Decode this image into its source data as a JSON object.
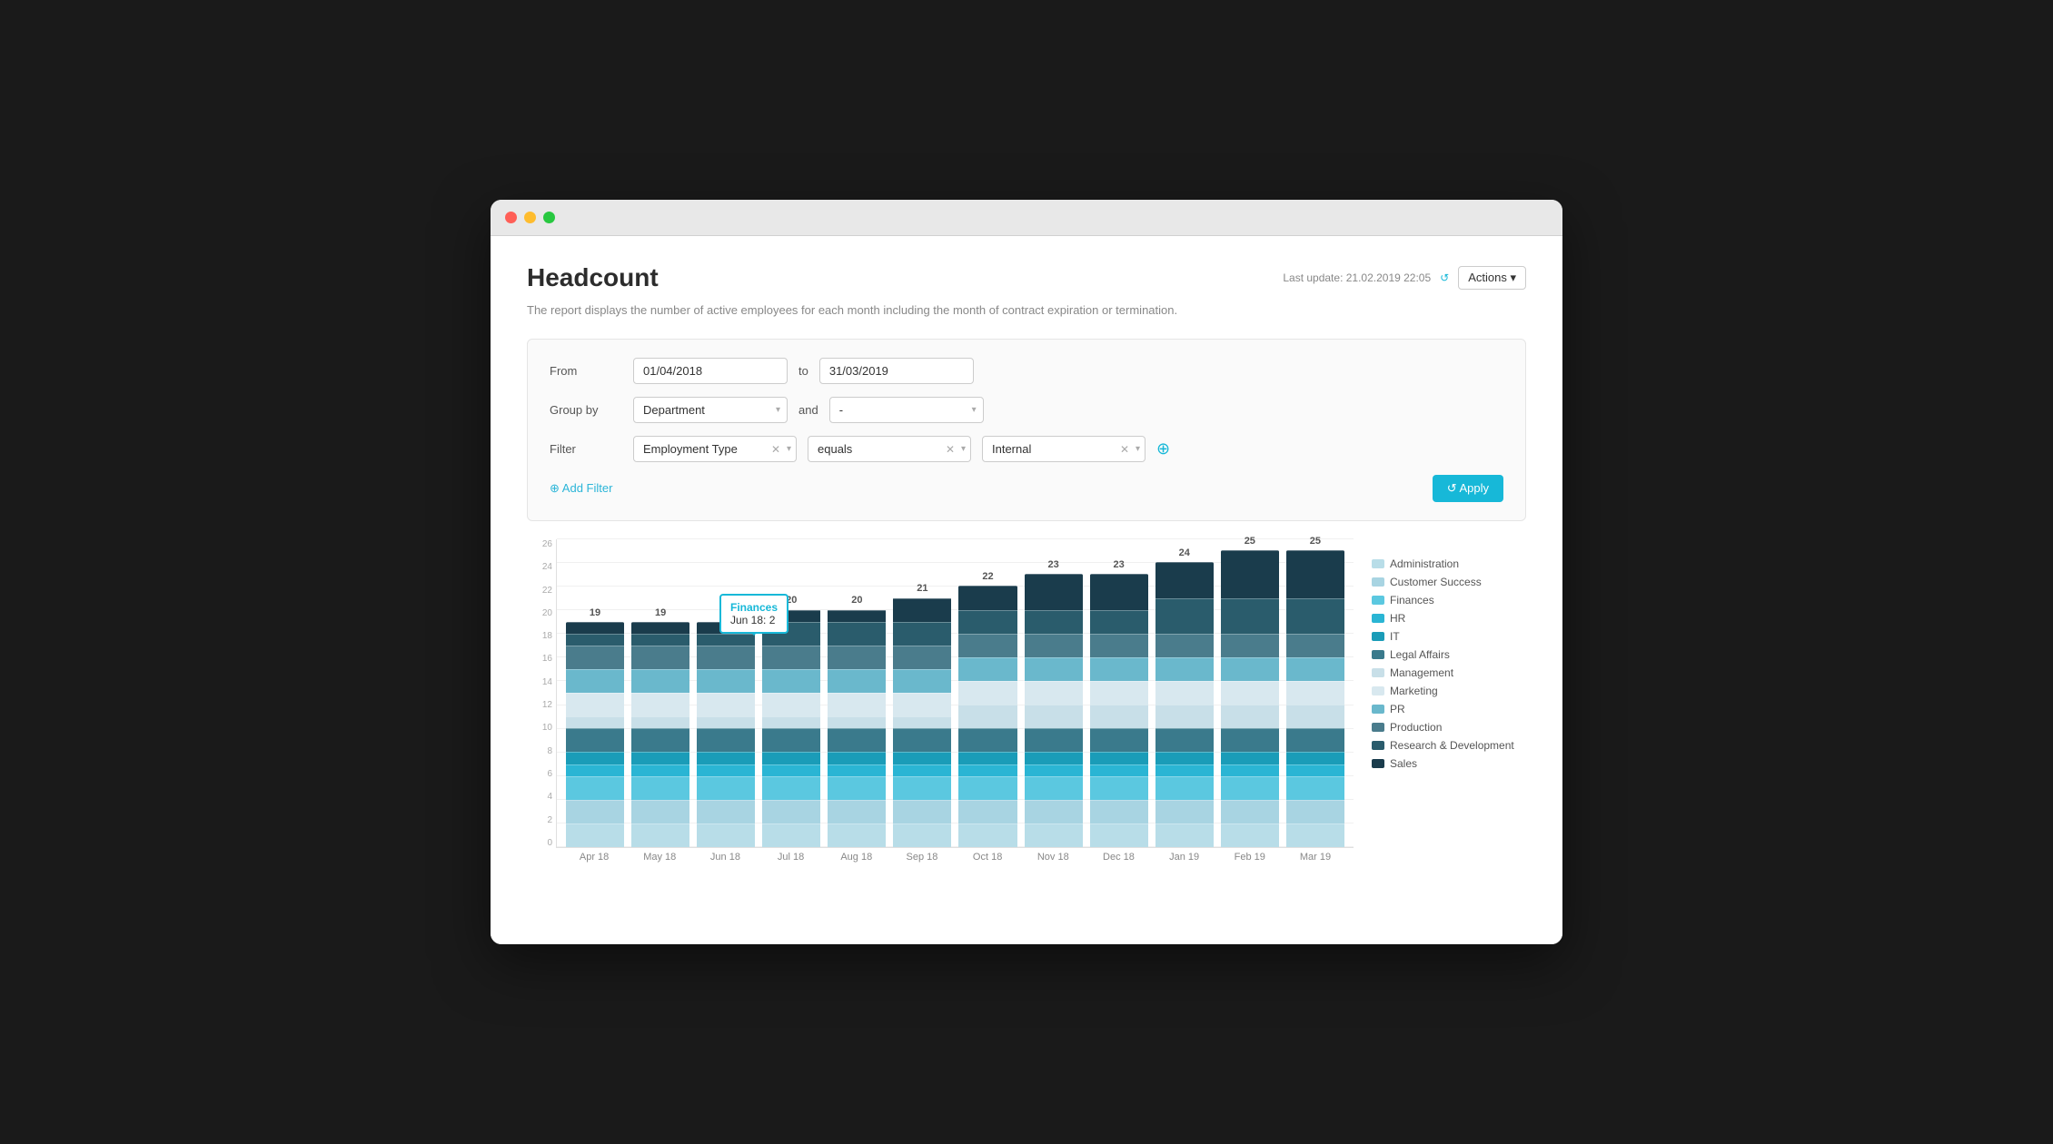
{
  "window": {
    "title": "Headcount"
  },
  "header": {
    "title": "Headcount",
    "last_update": "Last update: 21.02.2019 22:05",
    "actions_label": "Actions ▾",
    "description": "The report displays the number of active employees for each month including the month of contract expiration or termination."
  },
  "form": {
    "from_label": "From",
    "from_value": "01/04/2018",
    "to_label": "to",
    "to_value": "31/03/2019",
    "group_by_label": "Group by",
    "group_by_value": "Department",
    "and_label": "and",
    "and_value": "-",
    "filter_label": "Filter",
    "filter_field": "Employment Type",
    "filter_op": "equals",
    "filter_value": "Internal",
    "add_filter_label": "⊕ Add Filter",
    "apply_label": "↺ Apply"
  },
  "chart": {
    "bars": [
      {
        "month": "Apr 18",
        "total": 19,
        "segments": [
          2,
          2,
          2,
          1,
          1,
          2,
          1,
          2,
          2,
          2,
          1,
          1
        ]
      },
      {
        "month": "May 18",
        "total": 19,
        "segments": [
          2,
          2,
          2,
          1,
          1,
          2,
          1,
          2,
          2,
          2,
          1,
          1
        ]
      },
      {
        "month": "Jun 18",
        "total": 19,
        "segments": [
          2,
          2,
          2,
          1,
          1,
          2,
          1,
          2,
          2,
          2,
          1,
          1
        ]
      },
      {
        "month": "Jul 18",
        "total": 20,
        "segments": [
          2,
          2,
          2,
          1,
          1,
          2,
          1,
          2,
          2,
          2,
          2,
          1
        ]
      },
      {
        "month": "Aug 18",
        "total": 20,
        "segments": [
          2,
          2,
          2,
          1,
          1,
          2,
          1,
          2,
          2,
          2,
          2,
          1
        ]
      },
      {
        "month": "Sep 18",
        "total": 21,
        "segments": [
          2,
          2,
          2,
          1,
          1,
          2,
          1,
          2,
          2,
          2,
          2,
          2
        ]
      },
      {
        "month": "Oct 18",
        "total": 22,
        "segments": [
          2,
          2,
          2,
          1,
          1,
          2,
          2,
          2,
          2,
          2,
          2,
          2
        ]
      },
      {
        "month": "Nov 18",
        "total": 23,
        "segments": [
          2,
          2,
          2,
          1,
          1,
          2,
          2,
          2,
          2,
          2,
          2,
          3
        ]
      },
      {
        "month": "Dec 18",
        "total": 23,
        "segments": [
          2,
          2,
          2,
          1,
          1,
          2,
          2,
          2,
          2,
          2,
          2,
          3
        ]
      },
      {
        "month": "Jan 19",
        "total": 24,
        "segments": [
          2,
          2,
          2,
          1,
          1,
          2,
          2,
          2,
          2,
          2,
          3,
          3
        ]
      },
      {
        "month": "Feb 19",
        "total": 25,
        "segments": [
          2,
          2,
          2,
          1,
          1,
          2,
          2,
          2,
          2,
          2,
          3,
          4
        ]
      },
      {
        "month": "Mar 19",
        "total": 25,
        "segments": [
          2,
          2,
          2,
          1,
          1,
          2,
          2,
          2,
          2,
          2,
          3,
          4
        ]
      }
    ],
    "tooltip": {
      "title": "Finances",
      "subtitle": "Jun 18: 2"
    },
    "y_labels": [
      "0",
      "2",
      "4",
      "6",
      "8",
      "10",
      "12",
      "14",
      "16",
      "18",
      "20",
      "22",
      "24",
      "26"
    ],
    "legend": [
      {
        "label": "Administration",
        "color": "#b8dde8"
      },
      {
        "label": "Customer Success",
        "color": "#a8d4e2"
      },
      {
        "label": "Finances",
        "color": "#5bc8e0"
      },
      {
        "label": "HR",
        "color": "#2ab5d4"
      },
      {
        "label": "IT",
        "color": "#1a9cb8"
      },
      {
        "label": "Legal Affairs",
        "color": "#3a7a8c"
      },
      {
        "label": "Management",
        "color": "#c8dfe8"
      },
      {
        "label": "Marketing",
        "color": "#d8e8ef"
      },
      {
        "label": "PR",
        "color": "#6ab8cc"
      },
      {
        "label": "Production",
        "color": "#4a7c8c"
      },
      {
        "label": "Research & Development",
        "color": "#2a5c6c"
      },
      {
        "label": "Sales",
        "color": "#1a3c4c"
      }
    ]
  }
}
